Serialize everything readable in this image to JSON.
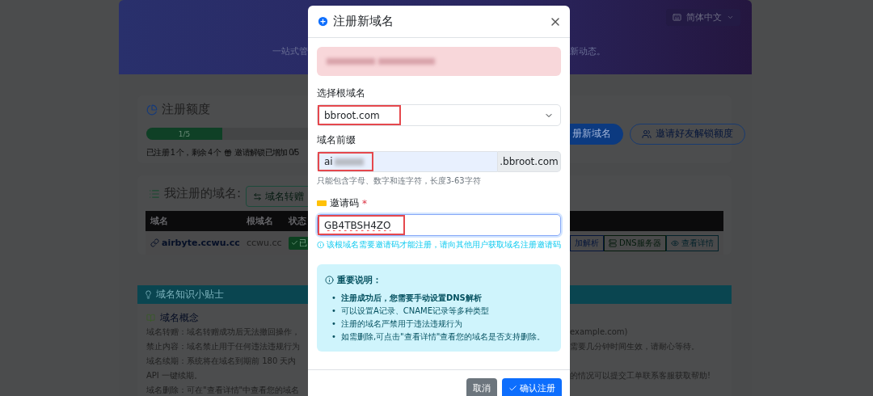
{
  "header": {
    "subtitle_left": "一站式管",
    "subtitle_right": "新动态。",
    "language": "简体中文"
  },
  "quota": {
    "title": "注册额度",
    "progress": {
      "label": "1/5",
      "level": 0.2
    },
    "summary": "已注册 1 个，剩余 4 个",
    "invite_unlock": "邀请解锁已增加 0/5",
    "buttons": [
      {
        "label": "册新域名",
        "kind": "primary"
      },
      {
        "label": "邀请好友解锁额度",
        "kind": "outline"
      }
    ]
  },
  "domains": {
    "title": "我注册的域名:",
    "transfer_button": "域名转赠",
    "columns": [
      "域名",
      "根域名",
      "状态"
    ],
    "rows": [
      {
        "domain": "airbyte.ccwu.cc",
        "root": "ccwu.cc",
        "status": "已",
        "actions": [
          {
            "label": "加解析",
            "kind": "primary"
          },
          {
            "label": "DNS服务器",
            "kind": "success"
          },
          {
            "label": "查看详情",
            "kind": "info"
          }
        ]
      }
    ]
  },
  "tips": {
    "title": "域名知识小贴士",
    "section": "域名概念",
    "lines": [
      {
        "left": "域名转赠：域名转赠成功后无法撤回操作，",
        "right": "example.com)"
      },
      {
        "left": "禁止内容：域名禁止用于任何违法违规行为",
        "right": "需要几分钟时间生效，请耐心等待。"
      },
      {
        "left": "域名续期：系统将在域名到期前 180 天内"
      },
      {
        "left": "API 一键续期。",
        "right": "的情况可以提交工单联系客服获取帮助!"
      },
      {
        "left": "域名删除：可在\"查看详情\"中查看您的域名"
      }
    ]
  },
  "modal": {
    "title": "注册新域名",
    "alert": {
      "redacted": true
    },
    "root_select": {
      "label": "选择根域名",
      "value": "bbroot.com",
      "highlighted": true
    },
    "prefix": {
      "label": "域名前缀",
      "value": "ai",
      "redacted": true,
      "addon": ".bbroot.com",
      "hint": "只能包含字母、数字和连字符，长度3-63字符",
      "highlighted": true
    },
    "invite": {
      "label": "邀请码",
      "required_mark": "*",
      "value": "GB4TBSH4ZO",
      "focused": true,
      "highlighted": true,
      "hint": "该根域名需要邀请码才能注册，请向其他用户获取域名注册邀请码"
    },
    "notice": {
      "title": "重要说明：",
      "bullet": "•",
      "items": [
        {
          "text": "注册成功后，您需要手动设置DNS解析",
          "bold": true
        },
        {
          "text": "可以设置A记录、CNAME记录等多种类型",
          "bold": false
        },
        {
          "text": "注册的域名严禁用于违法违规行为",
          "bold": false
        },
        {
          "text": "如需删除,可点击\"查看详情\"查看您的域名是否支持删除。",
          "bold": false
        }
      ]
    },
    "buttons": [
      {
        "label": "取消",
        "kind": "secondary"
      },
      {
        "label": "确认注册",
        "kind": "primary"
      }
    ]
  }
}
